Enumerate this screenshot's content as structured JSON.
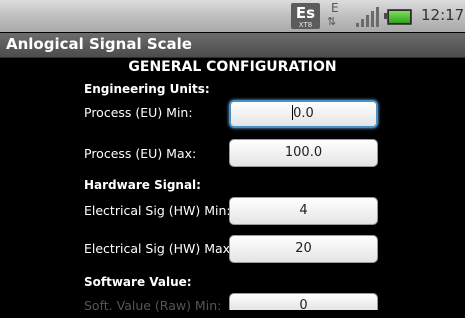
{
  "status_bar": {
    "app_icon_text": "Es",
    "app_icon_subtext": "XT8",
    "network_type": "E",
    "network_arrows": "⇅",
    "time": "12:17",
    "colors": {
      "battery_fill": "#4cc23a",
      "focus_ring": "#4a8fc6"
    }
  },
  "title_bar": {
    "title": "Anlogical Signal Scale"
  },
  "section": {
    "heading": "GENERAL CONFIGURATION"
  },
  "engineering_units": {
    "label": "Engineering Units:",
    "min_label": "Process (EU) Min:",
    "min_value": "0.0",
    "max_label": "Process (EU) Max:",
    "max_value": "100.0"
  },
  "hardware_signal": {
    "label": "Hardware Signal:",
    "min_label": "Electrical Sig (HW) Min:",
    "min_value": "4",
    "max_label": "Electrical Sig (HW) Max:",
    "max_value": "20"
  },
  "software_value": {
    "label": "Software Value:",
    "min_label": "Soft. Value (Raw) Min:",
    "min_value": "0"
  }
}
